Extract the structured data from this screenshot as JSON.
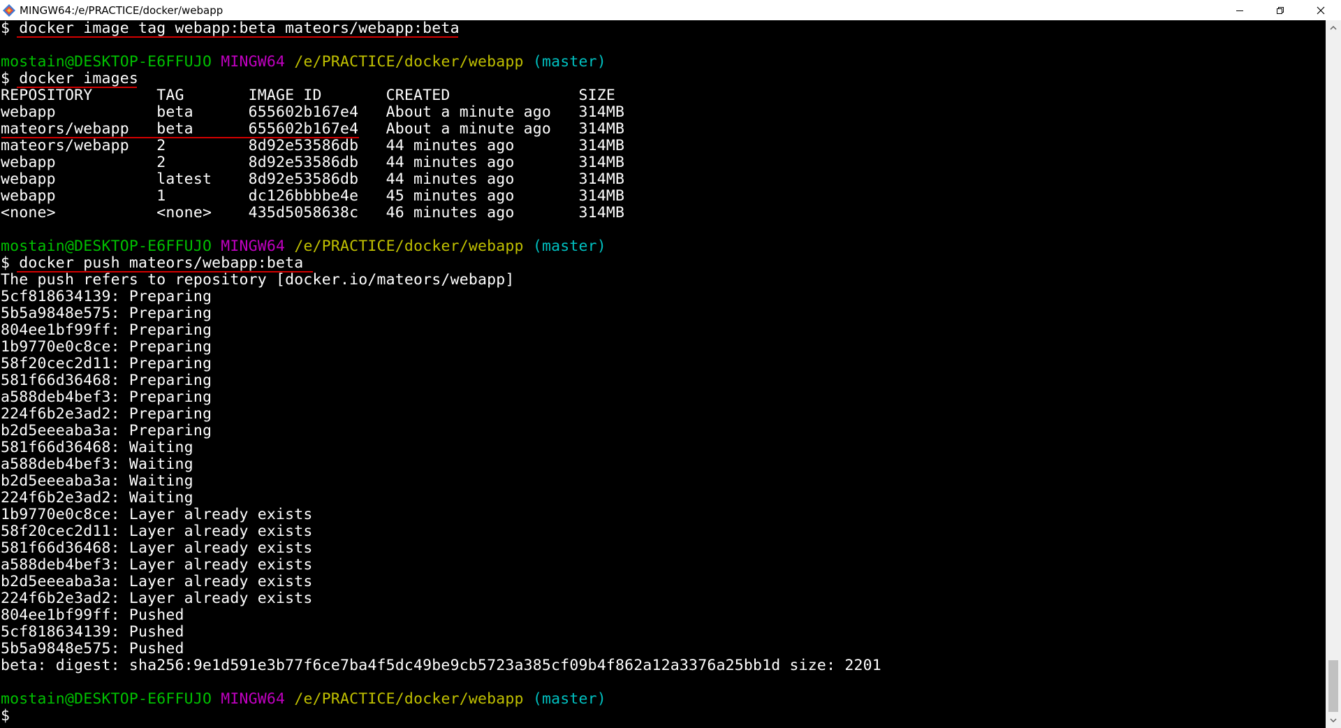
{
  "window": {
    "title": "MINGW64:/e/PRACTICE/docker/webapp"
  },
  "prompt": {
    "user_host": "mostain@DESKTOP-E6FFUJO",
    "system": "MINGW64",
    "path": "/e/PRACTICE/docker/webapp",
    "branch": "(master)"
  },
  "lines": {
    "l0": "$ docker image tag webapp:beta mateors/webapp:beta",
    "l2": "$ docker images",
    "l3": "REPOSITORY       TAG       IMAGE ID       CREATED              SIZE",
    "l4": "webapp           beta      655602b167e4   About a minute ago   314MB",
    "l5": "mateors/webapp   beta      655602b167e4   About a minute ago   314MB",
    "l6": "mateors/webapp   2         8d92e53586db   44 minutes ago       314MB",
    "l7": "webapp           2         8d92e53586db   44 minutes ago       314MB",
    "l8": "webapp           latest    8d92e53586db   44 minutes ago       314MB",
    "l9": "webapp           1         dc126bbbbe4e   45 minutes ago       314MB",
    "l10": "<none>           <none>    435d5058638c   46 minutes ago       314MB",
    "l13": "$ docker push mateors/webapp:beta",
    "l14": "The push refers to repository [docker.io/mateors/webapp]",
    "l15": "5cf818634139: Preparing",
    "l16": "5b5a9848e575: Preparing",
    "l17": "804ee1bf99ff: Preparing",
    "l18": "1b9770e0c8ce: Preparing",
    "l19": "58f20cec2d11: Preparing",
    "l20": "581f66d36468: Preparing",
    "l21": "a588deb4bef3: Preparing",
    "l22": "224f6b2e3ad2: Preparing",
    "l23": "b2d5eeeaba3a: Preparing",
    "l24": "581f66d36468: Waiting",
    "l25": "a588deb4bef3: Waiting",
    "l26": "b2d5eeeaba3a: Waiting",
    "l27": "224f6b2e3ad2: Waiting",
    "l28": "1b9770e0c8ce: Layer already exists",
    "l29": "58f20cec2d11: Layer already exists",
    "l30": "581f66d36468: Layer already exists",
    "l31": "a588deb4bef3: Layer already exists",
    "l32": "b2d5eeeaba3a: Layer already exists",
    "l33": "224f6b2e3ad2: Layer already exists",
    "l34": "804ee1bf99ff: Pushed",
    "l35": "5cf818634139: Pushed",
    "l36": "5b5a9848e575: Pushed",
    "l37": "beta: digest: sha256:9e1d591e3b77f6ce7ba4f5dc49be9cb5723a385cf09b4f862a12a3376a25bb1d size: 2201",
    "l40": "$"
  },
  "colors": {
    "background": "#000000",
    "foreground": "#ffffff",
    "user_host": "#00c000",
    "system": "#c000c0",
    "path": "#c0c000",
    "branch": "#00c0c0",
    "annotation_underline": "#d40000"
  },
  "icons": {
    "app": "git-bash-icon",
    "minimize": "minimize-icon",
    "maximize": "restore-icon",
    "close": "close-icon",
    "scroll_up": "chevron-up-icon",
    "scroll_down": "chevron-down-icon"
  }
}
